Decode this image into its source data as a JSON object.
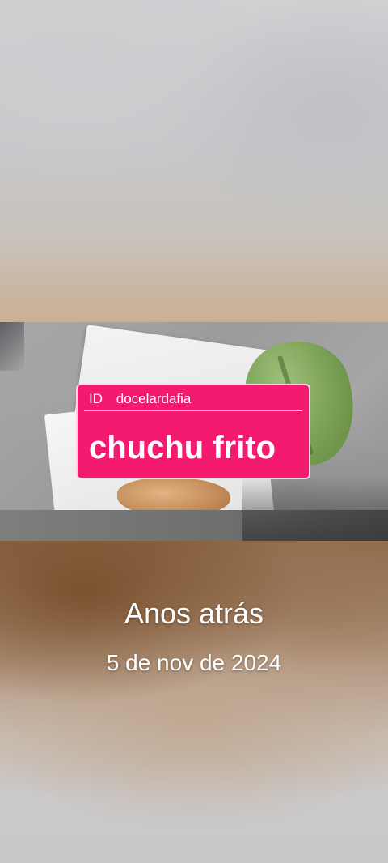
{
  "label": {
    "id_tag": "ID",
    "handle": "docelardafia",
    "title": "chuchu frito",
    "background_color": "#f41a70",
    "text_color": "#ffffff"
  },
  "memory": {
    "heading": "Anos atrás",
    "date": "5 de nov de 2024"
  }
}
